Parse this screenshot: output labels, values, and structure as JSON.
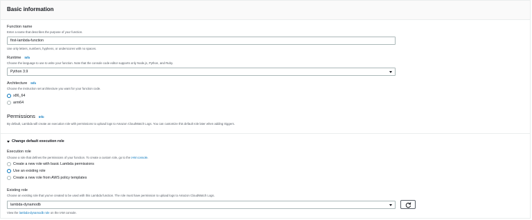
{
  "panel": {
    "title": "Basic information"
  },
  "function_name": {
    "label": "Function name",
    "description": "Enter a name that describes the purpose of your function.",
    "value": "first-lambda-function",
    "hint": "Use only letters, numbers, hyphens, or underscores with no spaces."
  },
  "runtime": {
    "label": "Runtime",
    "info": "Info",
    "description": "Choose the language to use to write your function. Note that the console code editor supports only Node.js, Python, and Ruby.",
    "selected": "Python 3.9"
  },
  "architecture": {
    "label": "Architecture",
    "info": "Info",
    "description": "Choose the instruction set architecture you want for your function code.",
    "options": [
      {
        "label": "x86_64",
        "checked": true
      },
      {
        "label": "arm64",
        "checked": false
      }
    ]
  },
  "permissions": {
    "title": "Permissions",
    "info": "Info",
    "description": "By default, Lambda will create an execution role with permissions to upload logs to Amazon CloudWatch Logs. You can customize this default role later when adding triggers."
  },
  "execution_role": {
    "expander_title": "Change default execution role",
    "label": "Execution role",
    "description_prefix": "Choose a role that defines the permissions of your function. To create a custom role, go to the ",
    "description_link": "IAM console",
    "description_suffix": ".",
    "options": [
      {
        "label": "Create a new role with basic Lambda permissions",
        "checked": false
      },
      {
        "label": "Use an existing role",
        "checked": true
      },
      {
        "label": "Create a new role from AWS policy templates",
        "checked": false
      }
    ]
  },
  "existing_role": {
    "label": "Existing role",
    "description": "Choose an existing role that you've created to be used with this Lambda function. The role must have permission to upload logs to Amazon CloudWatch Logs.",
    "selected": "lambda-dynamodb",
    "view_link_prefix": "View the ",
    "view_link_text": "lambda-dynamodb role",
    "view_link_suffix": " on the IAM console."
  },
  "colors": {
    "accent": "#0073bb",
    "text": "#16191f",
    "muted": "#545b64",
    "border": "#aab7b8"
  },
  "icons": [
    "radio-selected-icon",
    "radio-unselected-icon",
    "select-caret-icon",
    "expander-caret-icon",
    "refresh-icon"
  ]
}
